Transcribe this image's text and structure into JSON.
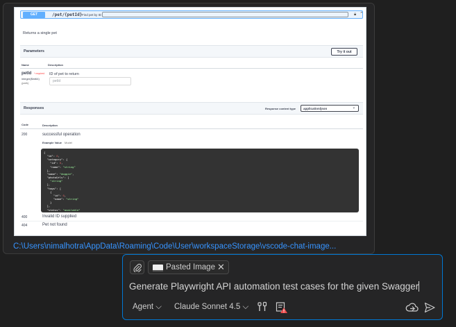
{
  "preview": {
    "path": "C:\\Users\\nimalhotra\\AppData\\Roaming\\Code\\User\\workspaceStorage\\vscode-chat-image...",
    "swagger": {
      "method": "GET",
      "path": "/pet/{petId}",
      "summary": "Find pet by ID",
      "description": "Returns a single pet",
      "parameters_title": "Parameters",
      "try_it_out": "Try it out",
      "col_name": "Name",
      "col_description": "Description",
      "param": {
        "name": "petId",
        "required": "* required",
        "type": "integer($int64)",
        "in": "(path)",
        "description": "ID of pet to return",
        "placeholder": "petId"
      },
      "responses_title": "Responses",
      "response_content_type_label": "Response content type",
      "response_content_type": "application/json",
      "col_code": "Code",
      "col_resp_description": "Description",
      "responses": [
        {
          "code": "200",
          "description": "successful operation"
        },
        {
          "code": "400",
          "description": "Invalid ID supplied"
        },
        {
          "code": "404",
          "description": "Pet not found"
        }
      ],
      "example_value": "Example Value",
      "model": "Model"
    }
  },
  "chat": {
    "attachment_label": "Pasted Image",
    "prompt_text": "Generate Playwright API automation test cases for the given Swagger",
    "mode": "Agent",
    "model": "Claude Sonnet 4.5",
    "colors": {
      "accent": "#0078d4",
      "link": "#3794ff",
      "warning": "#f14c4c"
    }
  }
}
